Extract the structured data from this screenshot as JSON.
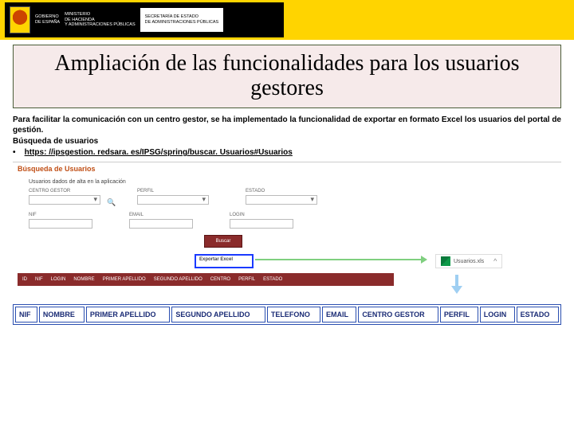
{
  "header": {
    "gov_line1": "GOBIERNO",
    "gov_line2": "DE ESPAÑA",
    "min_line1": "MINISTERIO",
    "min_line2": "DE HACIENDA",
    "min_line3": "Y ADMINISTRACIONES PÚBLICAS",
    "sec_line1": "SECRETARÍA DE ESTADO",
    "sec_line2": "DE ADMINISTRACIONES PÚBLICAS"
  },
  "title": "Ampliación de las funcionalidades para los usuarios gestores",
  "body": {
    "p1": "Para facilitar la comunicación con un centro gestor, se ha implementado la funcionalidad de exportar en formato Excel los usuarios del portal de gestión.",
    "p2": "Búsqueda de usuarios",
    "bullet": "•",
    "link": "https: //ipsgestion. redsara. es/IPSG/spring/buscar. Usuarios#Usuarios"
  },
  "screenshot": {
    "title": "Búsqueda de Usuarios",
    "subtitle": "Usuarios dados de alta en la aplicación",
    "labels": {
      "centro": "CENTRO GESTOR",
      "perfil": "PERFIL",
      "estado": "ESTADO",
      "nif": "NIF",
      "email": "EMAIL",
      "login": "LOGIN"
    },
    "buscar": "Buscar",
    "exportar": "Exportar Excel",
    "strip": [
      "ID",
      "NIF",
      "LOGIN",
      "NOMBRE",
      "PRIMER APELLIDO",
      "SEGUNDO APELLIDO",
      "CENTRO",
      "PERFIL",
      "ESTADO"
    ],
    "file": "Usuarios.xls",
    "chev": "^"
  },
  "excel_headers": [
    "NIF",
    "NOMBRE",
    "PRIMER APELLIDO",
    "SEGUNDO APELLIDO",
    "TELEFONO",
    "EMAIL",
    "CENTRO GESTOR",
    "PERFIL",
    "LOGIN",
    "ESTADO"
  ]
}
